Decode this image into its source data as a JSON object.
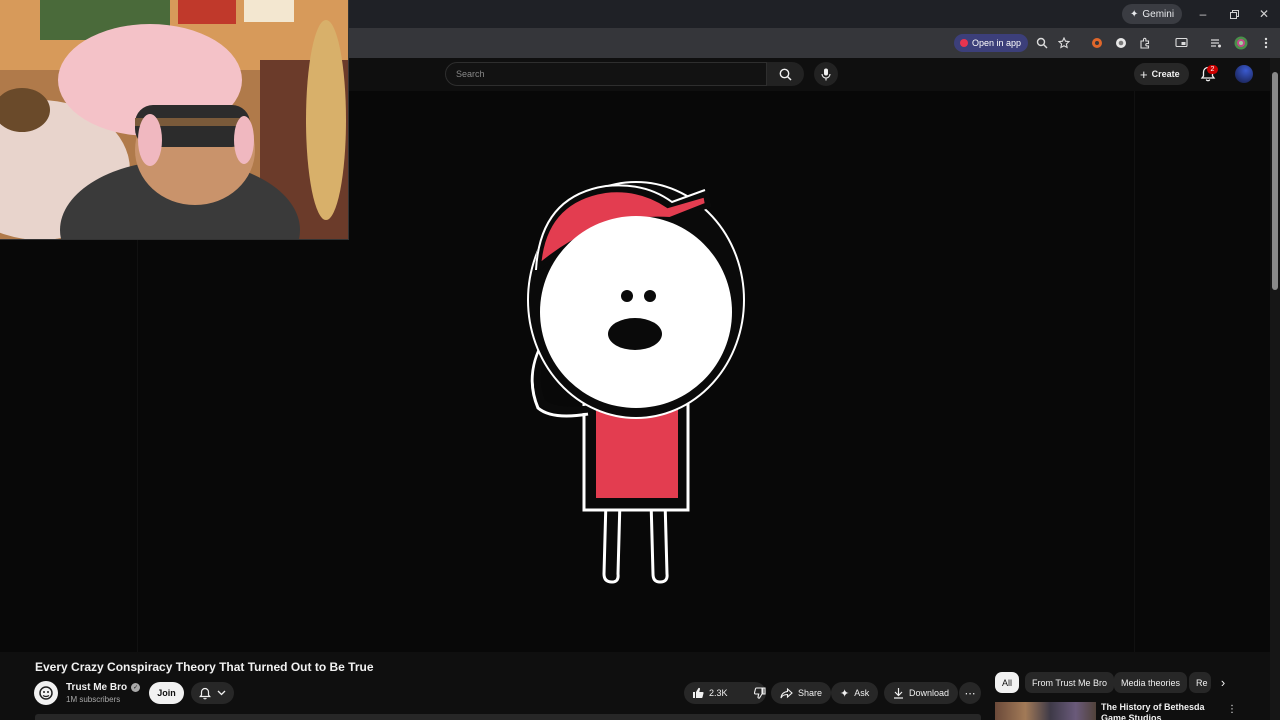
{
  "browser": {
    "gemini_label": "Gemini",
    "open_in_app_label": "Open in app",
    "window_controls": [
      "minimize-icon",
      "restore-icon",
      "close-icon"
    ],
    "toolbar_icons": [
      "zoom-icon",
      "star-icon",
      "extension-icon",
      "extensions-puzzle-icon",
      "cast-icon",
      "media-icon",
      "profile-icon",
      "menu-icon"
    ]
  },
  "masthead": {
    "search_placeholder": "Search",
    "create_label": "Create",
    "notification_count": "2"
  },
  "video": {
    "title": "Every Crazy Conspiracy Theory That Turned Out to Be True"
  },
  "channel": {
    "name": "Trust Me Bro",
    "subscribers": "1M subscribers",
    "join_label": "Join"
  },
  "actions": {
    "likes": "2.3K",
    "share_label": "Share",
    "ask_label": "Ask",
    "download_label": "Download"
  },
  "chips": [
    "All",
    "From Trust Me Bro",
    "Media theories",
    "Re"
  ],
  "recommendation": {
    "title": "The History of Bethesda Game Studios"
  },
  "colors": {
    "page_bg": "#0f0f0f",
    "video_bg": "#080808",
    "character_red": "#e33d50",
    "brand_red": "#cc0000",
    "open_app_bg": "#3c3f7a"
  }
}
